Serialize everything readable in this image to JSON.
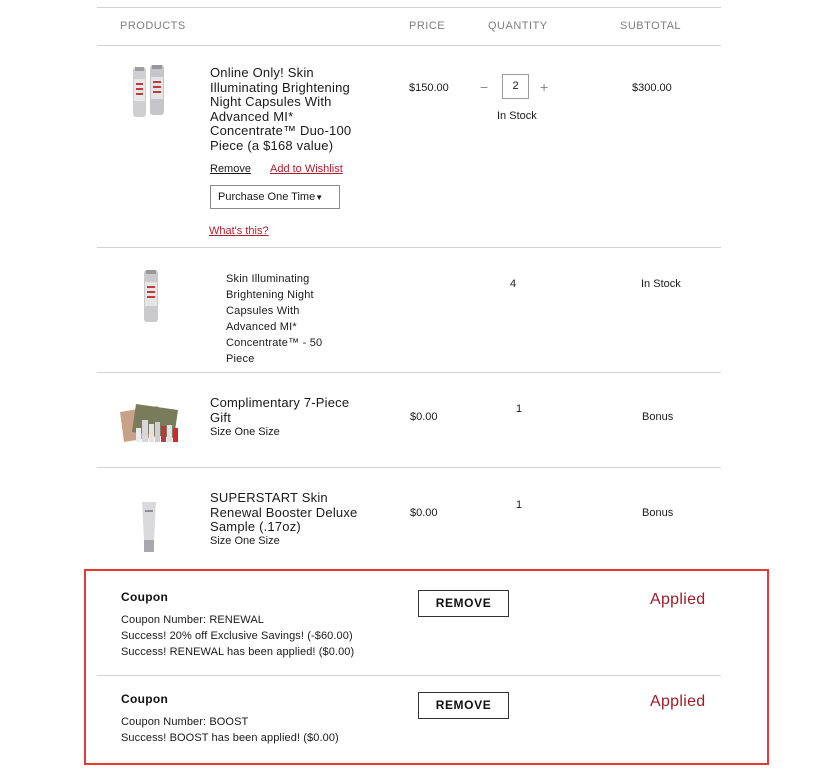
{
  "columns": {
    "products": "PRODUCTS",
    "price": "PRICE",
    "quantity": "QUANTITY",
    "subtotal": "SUBTOTAL"
  },
  "items": [
    {
      "name_lines": [
        "Online Only! Skin",
        "Illuminating Brightening",
        "Night Capsules With",
        "Advanced MI*",
        "Concentrate™ Duo-100",
        "Piece (a $168 value)"
      ],
      "price": "$150.00",
      "quantity": "2",
      "stock": "In Stock",
      "subtotal": "$300.00",
      "remove_label": "Remove",
      "wishlist_label": "Add to Wishlist",
      "purchase_option": "Purchase One Time",
      "whats_this": "What's this?"
    },
    {
      "name_lines": [
        "Skin Illuminating",
        "Brightening Night",
        "Capsules With",
        "Advanced MI*",
        "Concentrate™ - 50",
        "Piece"
      ],
      "quantity": "4",
      "subtotal": "In Stock"
    },
    {
      "name_lines": [
        "Complimentary 7-Piece",
        "Gift"
      ],
      "size": "Size One Size",
      "price": "$0.00",
      "quantity": "1",
      "subtotal": "Bonus"
    },
    {
      "name_lines": [
        "SUPERSTART Skin",
        "Renewal Booster Deluxe",
        "Sample (.17oz)"
      ],
      "size": "Size One Size",
      "price": "$0.00",
      "quantity": "1",
      "subtotal": "Bonus"
    }
  ],
  "coupons": [
    {
      "title": "Coupon",
      "lines": [
        "Coupon Number: RENEWAL",
        "Success! 20% off Exclusive Savings! (-$60.00)",
        "Success! RENEWAL has been applied! ($0.00)"
      ],
      "button": "REMOVE",
      "status": "Applied"
    },
    {
      "title": "Coupon",
      "lines": [
        "Coupon Number: BOOST",
        "Success! BOOST has been applied! ($0.00)"
      ],
      "button": "REMOVE",
      "status": "Applied"
    }
  ],
  "colors": {
    "accent_red": "#b01c2e",
    "highlight_border": "#e53935",
    "applied_text": "#a11a26"
  },
  "icons": [
    "minus-icon",
    "plus-icon",
    "caret-down-icon"
  ]
}
